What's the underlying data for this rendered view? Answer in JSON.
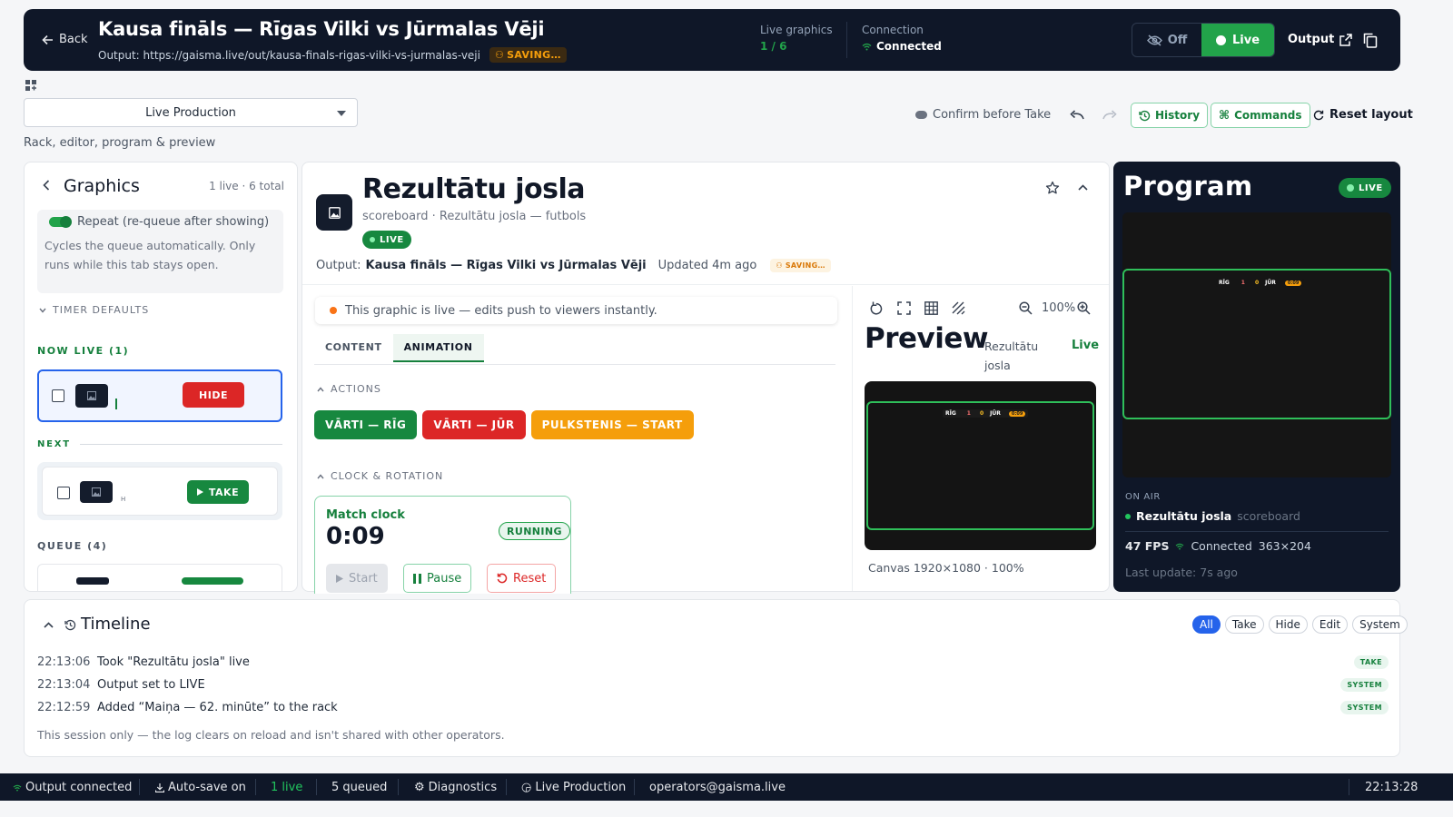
{
  "header": {
    "back_label": "Back",
    "title": "Kausa fināls — Rīgas Vilki vs Jūrmalas Vēji",
    "output_label": "Output: https://gaisma.live/out/kausa-finals-rigas-vilki-vs-jurmalas-veji",
    "saving_badge": "SAVING…",
    "live_graphics_label": "Live graphics",
    "live_graphics_value": "1 / 6",
    "connection_label": "Connection",
    "connection_value": "Connected",
    "off_label": "Off",
    "live_label": "Live",
    "output_button": "Output"
  },
  "toolbar": {
    "layout_select": "Live Production",
    "layout_caption": "Rack, editor, program & preview",
    "confirm_label": "Confirm before Take",
    "history_label": "History",
    "commands_label": "Commands",
    "reset_label": "Reset layout"
  },
  "rack": {
    "title": "Graphics",
    "count": "1 live · 6 total",
    "repeat_label": "Repeat (re-queue after showing)",
    "repeat_note": "Cycles the queue automatically. Only runs while this tab stays open.",
    "timer_defaults": "TIMER DEFAULTS",
    "now_live_header": "NOW LIVE (1)",
    "hide_label": "HIDE",
    "next_header": "NEXT",
    "next_item_short": "H",
    "take_label": "TAKE",
    "queue_header": "QUEUE (4)"
  },
  "editor": {
    "title": "Rezultātu josla",
    "subtitle": "scoreboard · Rezultātu josla — futbols",
    "live_badge": "LIVE",
    "output_prefix": "Output:",
    "output_name": "Kausa fināls — Rīgas Vilki vs Jūrmalas Vēji",
    "updated": "Updated 4m ago",
    "saving_badge": "SAVING…",
    "live_notice": "This graphic is live — edits push to viewers instantly.",
    "tabs": [
      "CONTENT",
      "ANIMATION"
    ],
    "actions_header": "ACTIONS",
    "actions": [
      {
        "label": "VĀRTI — RĪG",
        "color": "#17883f"
      },
      {
        "label": "VĀRTI — JŪR",
        "color": "#dc2626"
      },
      {
        "label": "PULKSTENIS — START",
        "color": "#f59e0b"
      }
    ],
    "clock_header": "CLOCK & ROTATION",
    "clock_label": "Match clock",
    "clock_value": "0:09",
    "clock_status": "RUNNING",
    "start_label": "Start",
    "pause_label": "Pause",
    "reset_label": "Reset"
  },
  "preview": {
    "zoom": "100%",
    "title": "Preview",
    "graphic_name": "Rezultātu josla",
    "live_label": "Live",
    "canvas_info": "Canvas 1920×1080 · 100%"
  },
  "scoreboard": {
    "home": "RĪG",
    "home_score": "1",
    "away_score": "0",
    "away": "JŪR",
    "clock": "0:09"
  },
  "program": {
    "title": "Program",
    "live_badge": "LIVE",
    "on_air_label": "ON AIR",
    "on_air_name": "Rezultātu josla",
    "on_air_type": "scoreboard",
    "fps": "47 FPS",
    "conn": "Connected",
    "size": "363×204",
    "last_update": "Last update: 7s ago"
  },
  "timeline": {
    "title": "Timeline",
    "filters": [
      "All",
      "Take",
      "Hide",
      "Edit",
      "System"
    ],
    "entries": [
      {
        "time": "22:13:06",
        "text": "Took \"Rezultātu josla\" live",
        "tag": "TAKE"
      },
      {
        "time": "22:13:04",
        "text": "Output set to LIVE",
        "tag": "SYSTEM"
      },
      {
        "time": "22:12:59",
        "text": "Added “Maiņa — 62. minūte” to the rack",
        "tag": "SYSTEM"
      }
    ],
    "note": "This session only — the log clears on reload and isn't shared with other operators."
  },
  "statusbar": {
    "output": "Output connected",
    "autosave": "Auto-save on",
    "live": "1 live",
    "queued": "5 queued",
    "diagnostics": "Diagnostics",
    "layout": "Live Production",
    "user": "operators@gaisma.live",
    "clock": "22:13:28"
  },
  "colors": {
    "topbar_bg": "#0f1728",
    "accent_green": "#22a34a",
    "danger_red": "#dc2626",
    "warning_amber": "#f59e0b",
    "filter_active": "#2563eb"
  }
}
